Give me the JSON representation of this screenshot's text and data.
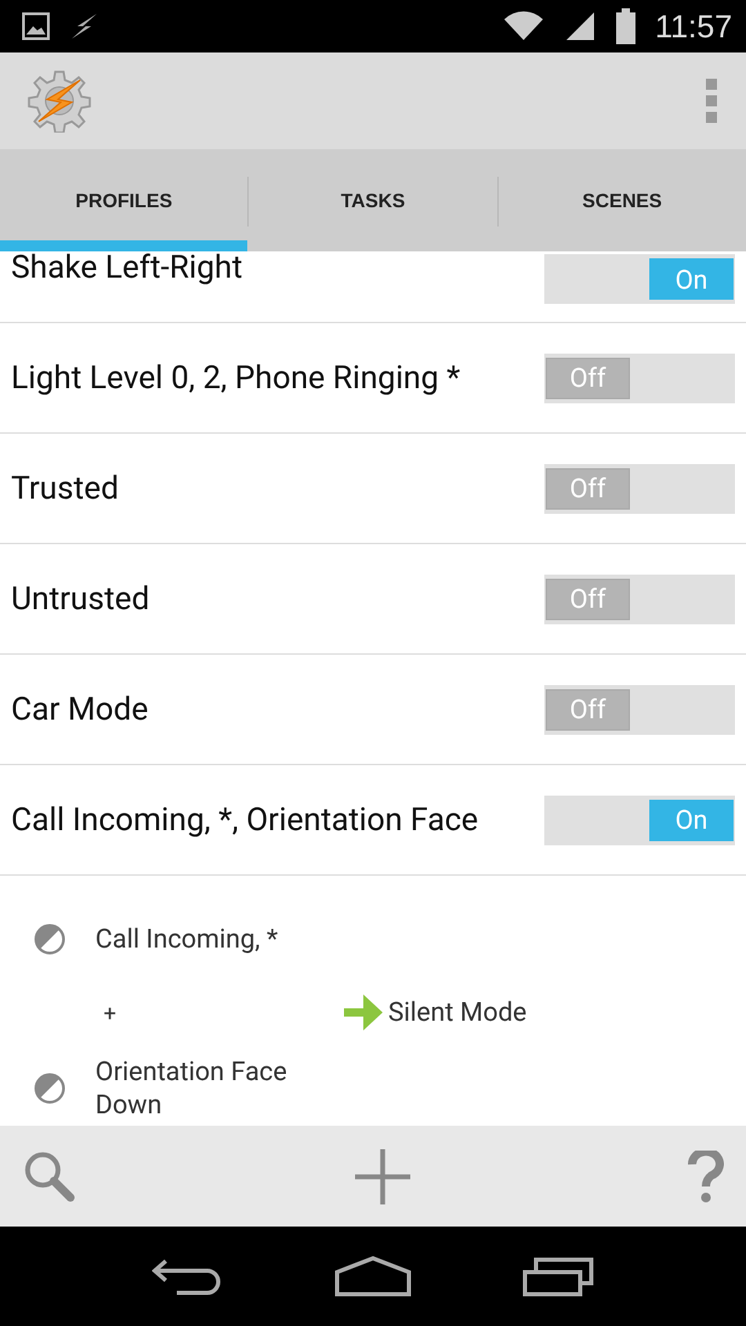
{
  "status_bar": {
    "time": "11:57"
  },
  "tabs": [
    {
      "label": "PROFILES",
      "selected": true
    },
    {
      "label": "TASKS",
      "selected": false
    },
    {
      "label": "SCENES",
      "selected": false
    }
  ],
  "profiles": [
    {
      "name": "Shake Left-Right",
      "on": true,
      "toggle": "On"
    },
    {
      "name": "Light Level 0, 2, Phone Ringing *",
      "on": false,
      "toggle": "Off"
    },
    {
      "name": "Trusted",
      "on": false,
      "toggle": "Off"
    },
    {
      "name": "Untrusted",
      "on": false,
      "toggle": "Off"
    },
    {
      "name": "Car Mode",
      "on": false,
      "toggle": "Off"
    },
    {
      "name": "Call Incoming, *, Orientation Face",
      "on": true,
      "toggle": "On"
    }
  ],
  "profile_detail": {
    "contexts": [
      "Call Incoming, *",
      "Orientation Face Down"
    ],
    "joiner": "+",
    "task": "Silent Mode"
  }
}
